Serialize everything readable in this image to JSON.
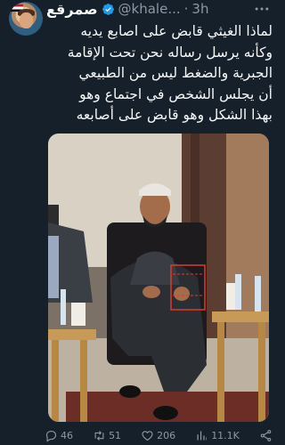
{
  "author": {
    "display_name": "صمرقع",
    "handle": "@khale...",
    "separator": "·",
    "time": "3h"
  },
  "tweet": {
    "lines": [
      "لماذا الغيثي قابض على اصابع يديه",
      "وكأنه يرسل رساله نحن تحت الإقامة",
      "الجبرية والضغط ليس من الطبيعي",
      "أن يجلس الشخص في اجتماع وهو",
      "بهذا الشكل وهو قابض على أصابعه"
    ]
  },
  "actions": {
    "replies": "46",
    "retweets": "51",
    "likes": "206",
    "views": "11.1K"
  },
  "icons": [
    "verified-icon",
    "more-icon",
    "reply-icon",
    "retweet-icon",
    "like-icon",
    "views-icon",
    "share-icon"
  ],
  "colors": {
    "background": "#15202b",
    "text": "#f7f9f9",
    "secondary": "#8b98a5",
    "verified": "#1d9bf0",
    "highlight_box": "#e0392b"
  }
}
